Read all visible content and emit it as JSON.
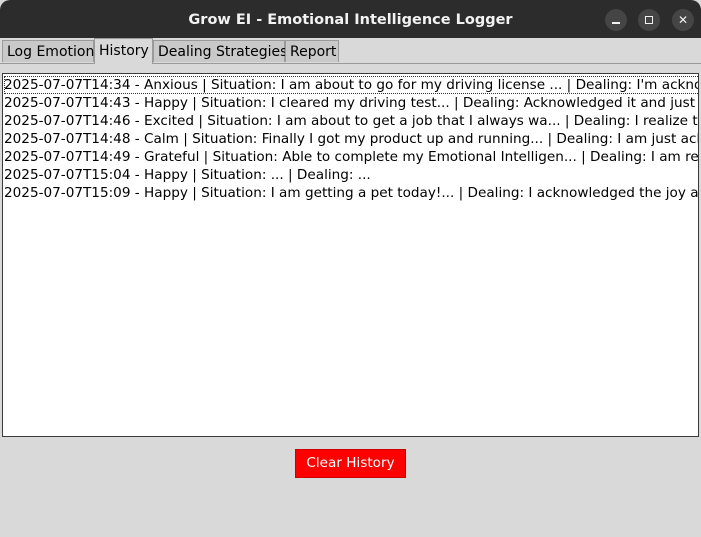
{
  "window": {
    "title": "Grow EI - Emotional Intelligence Logger",
    "controls": {
      "minimize_icon": "minimize-icon",
      "maximize_icon": "maximize-icon",
      "close_icon": "close-icon",
      "close_glyph": "✕"
    }
  },
  "tabs": [
    {
      "label": "Log Emotion",
      "active": false
    },
    {
      "label": "History",
      "active": true
    },
    {
      "label": "Dealing Strategies",
      "active": false
    },
    {
      "label": "Report",
      "active": false
    }
  ],
  "history": {
    "entries": [
      "2025-07-07T14:34 - Anxious | Situation: I am about to go for my driving license ... | Dealing: I'm acknowledged",
      "2025-07-07T14:43 - Happy | Situation: I cleared my driving test... | Dealing: Acknowledged it and just stayed",
      "2025-07-07T14:46 - Excited | Situation: I am about to get a job that I always wa... | Dealing: I realize the exc",
      "2025-07-07T14:48 - Calm | Situation: Finally I got my product up and running... | Dealing: I am just acknowle",
      "2025-07-07T14:49 - Grateful | Situation: Able to complete my Emotional Intelligen... | Dealing: I am really fo",
      "2025-07-07T15:04 - Happy | Situation: ... | Dealing: ...",
      "2025-07-07T15:09 - Happy | Situation: I am getting a pet today!... | Dealing: I acknowledged the joy and exp"
    ],
    "clear_button_label": "Clear History"
  },
  "colors": {
    "titlebar": "#2c2c2c",
    "window_bg": "#d9d9d9",
    "clear_button_bg": "#ff0000",
    "clear_button_text": "#ffffff"
  }
}
